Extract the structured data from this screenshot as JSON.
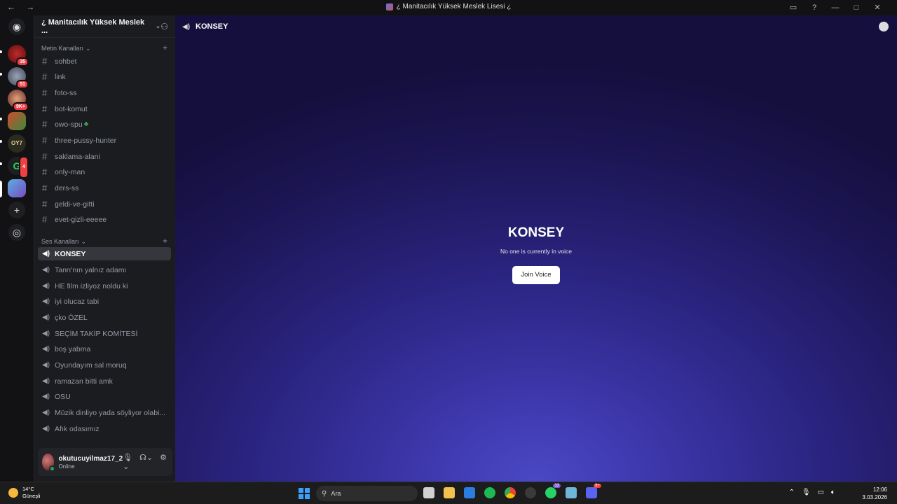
{
  "titlebar": {
    "title": "¿ Manitacılık Yüksek Meslek Lisesi ¿",
    "nav": "← →"
  },
  "rail": {
    "badges": [
      "35",
      "51",
      "9K+",
      "4"
    ]
  },
  "sidebar": {
    "guild_name": "¿ Manitacılık Yüksek Meslek ...",
    "text_category": "Metin Kanalları",
    "voice_category": "Ses Kanalları",
    "text_channels": [
      "sohbet",
      "link",
      "foto-ss",
      "bot-komut",
      "owo-spu",
      "three-pussy-hunter",
      "saklama-alani",
      "only-man",
      "ders-ss",
      "geldi-ve-gitti",
      "evet-gizli-eeeee"
    ],
    "voice_channels": [
      "KONSEY",
      "Tanrı'nın yalnız adamı",
      "HE film izliyoz noldu ki",
      "iyi olucaz tabi",
      "çko ÖZEL",
      "SEÇİM TAKİP KOMİTESİ",
      "boş yabma",
      "Oyundayım sal moruq",
      "ramazan bitti amk",
      "OSU",
      "Müzik dinliyo yada söyliyor olabi...",
      "Afık odasımız"
    ],
    "active_channel": "KONSEY"
  },
  "user": {
    "name": "okutucuyilmaz17_2",
    "status": "Online"
  },
  "main": {
    "channel_title": "KONSEY",
    "voice_title": "KONSEY",
    "voice_subtitle": "No one is currently in voice",
    "join_label": "Join Voice"
  },
  "taskbar": {
    "temp": "14°C",
    "weather": "Güneşli",
    "search_placeholder": "Ara",
    "app_badges": [
      "33",
      "9+"
    ],
    "time": "12:06",
    "date": "3.03.2026"
  },
  "colors": {
    "accent": "#5865f2",
    "online": "#23a55a",
    "badge": "#f23f43"
  }
}
